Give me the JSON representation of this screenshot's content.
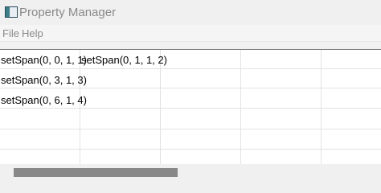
{
  "window": {
    "title": "Property Manager"
  },
  "menu": {
    "items": [
      "File",
      "Help"
    ]
  },
  "table": {
    "cells": [
      {
        "row": 0,
        "col": 0,
        "text": "setSpan(0, 0, 1, 1)"
      },
      {
        "row": 0,
        "col": 1,
        "text": "setSpan(0, 1, 1, 2)"
      },
      {
        "row": 1,
        "col": 0,
        "text": "setSpan(0, 3, 1, 3)"
      },
      {
        "row": 2,
        "col": 0,
        "text": "setSpan(0, 6, 1, 4)"
      }
    ]
  },
  "scrollbar": {
    "horizontal_thumb_fraction": 0.45
  }
}
